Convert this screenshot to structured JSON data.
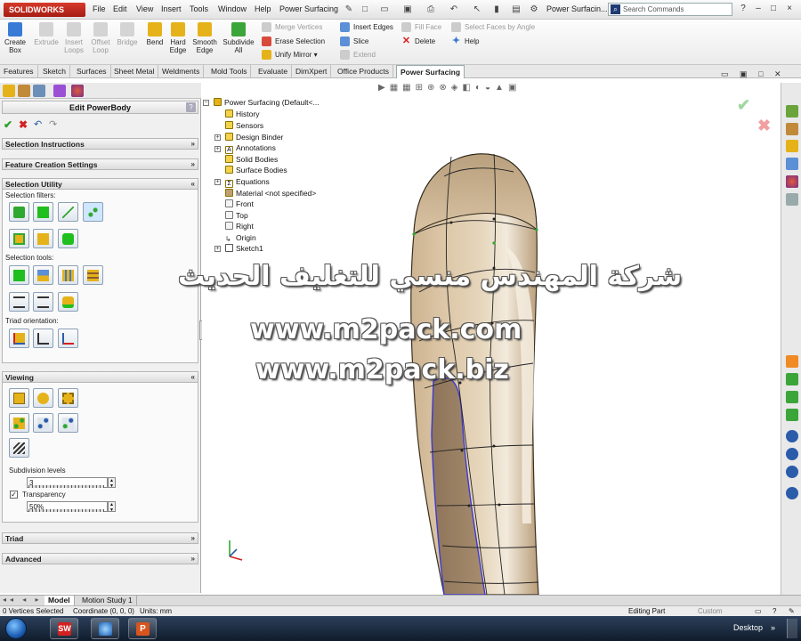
{
  "app": {
    "logo": "SOLIDWORKS",
    "menu": [
      "File",
      "Edit",
      "View",
      "Insert",
      "Tools",
      "Window",
      "Help",
      "Power Surfacing"
    ],
    "doc_title": "Power Surfacin...",
    "search_placeholder": "Search Commands",
    "window_controls": [
      "?",
      "–",
      "□",
      "×"
    ]
  },
  "ribbon": {
    "large_buttons": [
      {
        "label": "Create\nBox",
        "icon": "create-box-icon",
        "enabled": true,
        "color": "#3a7bd5"
      },
      {
        "label": "Extrude",
        "icon": "extrude-icon",
        "enabled": false,
        "color": "#cccccc"
      },
      {
        "label": "Insert\nLoops",
        "icon": "insert-loops-icon",
        "enabled": false,
        "color": "#cccccc"
      },
      {
        "label": "Offset\nLoop",
        "icon": "offset-loop-icon",
        "enabled": false,
        "color": "#cccccc"
      },
      {
        "label": "Bridge",
        "icon": "bridge-icon",
        "enabled": false,
        "color": "#cccccc"
      },
      {
        "label": "Bend",
        "icon": "bend-icon",
        "enabled": true,
        "color": "#e5b21a"
      },
      {
        "label": "Hard\nEdge",
        "icon": "hard-edge-icon",
        "enabled": true,
        "color": "#e5b21a"
      },
      {
        "label": "Smooth\nEdge",
        "icon": "smooth-edge-icon",
        "enabled": true,
        "color": "#e5b21a"
      },
      {
        "label": "Subdivide\nAll",
        "icon": "subdivide-all-icon",
        "enabled": true,
        "color": "#3ca53a"
      }
    ],
    "small_col1": [
      {
        "label": "Merge Vertices",
        "icon": "merge-vertices-icon",
        "enabled": false
      },
      {
        "label": "Erase Selection",
        "icon": "erase-selection-icon",
        "enabled": true
      },
      {
        "label": "Unify Mirror",
        "icon": "unify-mirror-icon",
        "enabled": true
      }
    ],
    "small_col2": [
      {
        "label": "Insert Edges",
        "icon": "insert-edges-icon",
        "enabled": true
      },
      {
        "label": "Slice",
        "icon": "slice-icon",
        "enabled": true
      },
      {
        "label": "Extend",
        "icon": "extend-icon",
        "enabled": false
      }
    ],
    "small_col3": [
      {
        "label": "Fill Face",
        "icon": "fill-face-icon",
        "enabled": false
      },
      {
        "label": "Delete",
        "icon": "delete-icon",
        "enabled": true
      }
    ],
    "small_col4": [
      {
        "label": "Select Faces by Angle",
        "icon": "select-faces-by-angle-icon",
        "enabled": false
      },
      {
        "label": "Help",
        "icon": "help-icon",
        "enabled": true
      }
    ]
  },
  "tabs": [
    "Features",
    "Sketch",
    "Surfaces",
    "Sheet Metal",
    "Weldments",
    "Mold Tools",
    "Evaluate",
    "DimXpert",
    "Office Products",
    "Power Surfacing"
  ],
  "active_tab": "Power Surfacing",
  "left_panel": {
    "title": "Edit PowerBody",
    "sections": {
      "selection_instructions": "Selection Instructions",
      "feature_creation_settings": "Feature Creation Settings",
      "selection_utility": "Selection Utility",
      "viewing": "Viewing",
      "triad": "Triad",
      "advanced": "Advanced"
    },
    "selection_filters_label": "Selection filters:",
    "selection_tools_label": "Selection tools:",
    "triad_orientation_label": "Triad orientation:",
    "subdivision_levels_label": "Subdivision levels",
    "subdivision_levels_value": "3",
    "transparency_label": "Transparency",
    "transparency_checked": true,
    "transparency_value": "50%"
  },
  "feature_tree": {
    "root": "Power Surfacing  (Default<...",
    "items": [
      "History",
      "Sensors",
      "Design Binder",
      "Annotations",
      "Solid Bodies",
      "Surface Bodies",
      "Equations",
      "Material <not specified>",
      "Front",
      "Top",
      "Right",
      "Origin",
      "Sketch1"
    ]
  },
  "model_tabs": [
    "Model",
    "Motion Study 1"
  ],
  "status": {
    "left": "0 Vertices Selected",
    "coordinate": "Coordinate (0, 0, 0)",
    "units": "Units: mm",
    "mode": "Editing Part",
    "custom": "Custom"
  },
  "taskbar": {
    "desktop": "Desktop"
  },
  "watermark": {
    "arabic": "شركة المهندس منسي للتغليف الحديث",
    "url1": "www.m2pack.com",
    "url2": "www.m2pack.biz"
  },
  "colors": {
    "accent": "#3a7bd5",
    "model_surface": "#d9c3a3",
    "model_shadow": "#8c735a",
    "edge_highlight": "#3d3bd0"
  }
}
